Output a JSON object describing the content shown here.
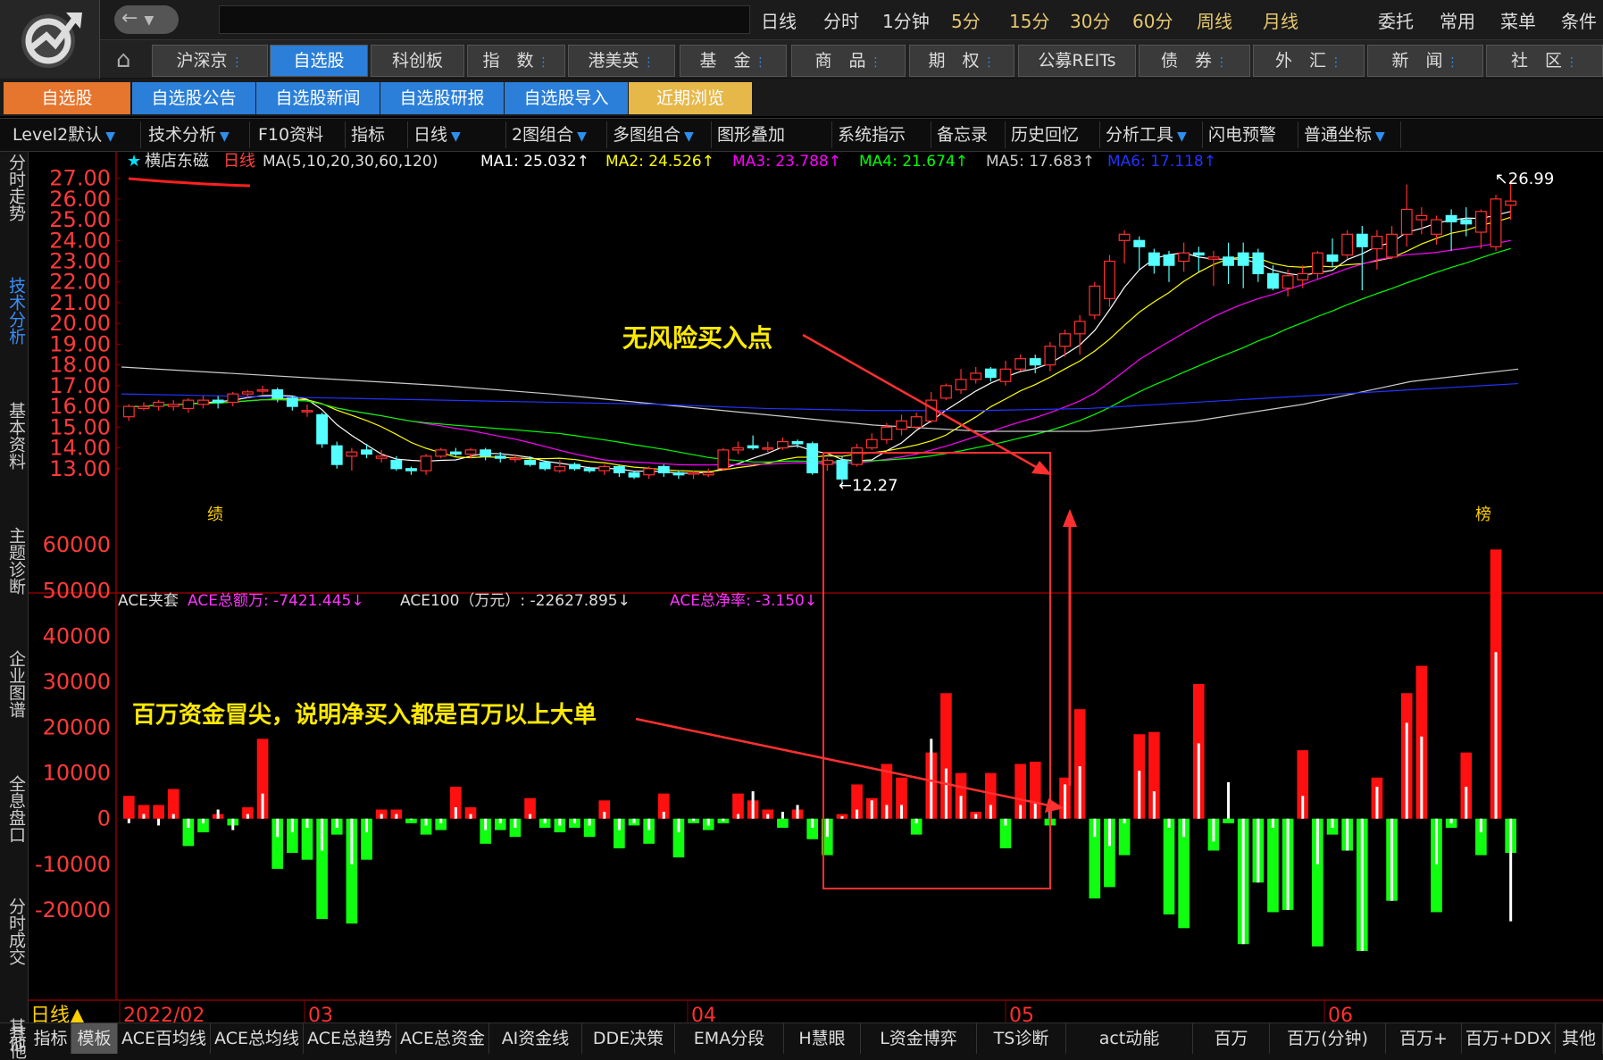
{
  "app": {
    "back_label": "←",
    "dropdown_icon": "chevron-down-icon"
  },
  "timeframes": [
    "日线",
    "分时",
    "1分钟",
    "5分",
    "15分",
    "30分",
    "60分",
    "周线",
    "月线"
  ],
  "top_right": [
    "委托",
    "常用",
    "菜单",
    "条件"
  ],
  "markets": [
    "沪深京",
    "自选股",
    "科创板",
    "指　数",
    "港美英",
    "基　金",
    "商　品",
    "期　权",
    "公募REITs",
    "债　券",
    "外　汇",
    "新　闻",
    "社　区"
  ],
  "subtabs": [
    "自选股",
    "自选股公告",
    "自选股新闻",
    "自选股研报",
    "自选股导入",
    "近期浏览"
  ],
  "toolbar": [
    "Level2默认",
    "技术分析",
    "F10资料",
    "指标",
    "日线",
    "2图组合",
    "多图组合",
    "图形叠加",
    "系统指示",
    "备忘录",
    "历史回忆",
    "分析工具",
    "闪电预警",
    "普通坐标"
  ],
  "side_tabs": [
    "分时走势",
    "技术分析",
    "基本资料",
    "主题诊断",
    "企业图谱",
    "全息盘口",
    "分时成交",
    "其他"
  ],
  "stock": {
    "name": "横店东磁",
    "period": "日线",
    "ma_params": "MA(5,10,20,30,60,120)",
    "ma": [
      {
        "label": "MA1:",
        "value": "25.032↑",
        "color": "#ffffff"
      },
      {
        "label": "MA2:",
        "value": "24.526↑",
        "color": "#ffff00"
      },
      {
        "label": "MA3:",
        "value": "23.788↑",
        "color": "#ff00ff"
      },
      {
        "label": "MA4:",
        "value": "21.674↑",
        "color": "#00ff00"
      },
      {
        "label": "MA5:",
        "value": "17.683↑",
        "color": "#cccccc"
      },
      {
        "label": "MA6:",
        "value": "17.118↑",
        "color": "#0000ff"
      }
    ]
  },
  "price_axis": [
    "27.00",
    "26.00",
    "25.00",
    "24.00",
    "23.00",
    "22.00",
    "21.00",
    "20.00",
    "19.00",
    "18.00",
    "17.00",
    "16.00",
    "15.00",
    "14.00",
    "13.00"
  ],
  "markers": {
    "high": "26.99",
    "low": "12.27",
    "left": "绩",
    "right": "榜"
  },
  "ace": {
    "title": "ACE夹套",
    "total_label": "ACE总额万:",
    "total": "-7421.445↓",
    "a100_label": "ACE100（万元）:",
    "a100": "-22627.895↓",
    "rate_label": "ACE总净率:",
    "rate": "-3.150↓"
  },
  "vol_axis": [
    "60000",
    "50000",
    "40000",
    "30000",
    "20000",
    "10000",
    "0",
    "-10000",
    "-20000"
  ],
  "dates": {
    "period_label": "日线▲",
    "d1": "2022/02",
    "d2": "03",
    "d3": "04",
    "d4": "05",
    "d5": "06"
  },
  "annotations": {
    "a1": "无风险买入点",
    "a2": "百万资金冒尖，说明净买入都是百万以上大单"
  },
  "bottom_tabs": [
    "指标",
    "模板",
    "ACE百均线",
    "ACE总均线",
    "ACE总趋势",
    "ACE总资金",
    "AI资金线",
    "DDE决策",
    "EMA分段",
    "H慧眼",
    "L资金博弈",
    "TS诊断",
    "act动能",
    "百万",
    "百万(分钟)",
    "百万+",
    "百万+DDX",
    "其他"
  ],
  "chart_data": {
    "type": "candlestick",
    "ylim": [
      12,
      27.5
    ],
    "candles": [
      [
        15.5,
        16.0,
        15.3,
        16.1
      ],
      [
        15.9,
        16.0,
        15.8,
        16.2
      ],
      [
        16.0,
        16.2,
        15.8,
        16.3
      ],
      [
        16.0,
        16.1,
        15.8,
        16.3
      ],
      [
        15.9,
        16.3,
        15.7,
        16.4
      ],
      [
        16.1,
        16.3,
        15.9,
        16.5
      ],
      [
        16.3,
        16.2,
        15.9,
        16.5
      ],
      [
        16.2,
        16.6,
        16.0,
        16.7
      ],
      [
        16.6,
        16.7,
        16.4,
        16.8
      ],
      [
        16.8,
        16.8,
        16.6,
        17.0
      ],
      [
        16.8,
        16.4,
        16.2,
        16.9
      ],
      [
        16.4,
        16.0,
        15.8,
        16.5
      ],
      [
        15.8,
        15.8,
        15.5,
        16.1
      ],
      [
        15.6,
        14.2,
        14.0,
        15.7
      ],
      [
        14.1,
        13.2,
        13.0,
        14.3
      ],
      [
        13.6,
        13.8,
        12.9,
        14.0
      ],
      [
        13.9,
        13.7,
        13.5,
        14.2
      ],
      [
        13.5,
        13.6,
        13.3,
        13.9
      ],
      [
        13.4,
        13.0,
        12.9,
        13.6
      ],
      [
        13.0,
        12.9,
        12.7,
        13.1
      ],
      [
        12.9,
        13.6,
        12.7,
        13.7
      ],
      [
        13.6,
        13.9,
        13.5,
        14.0
      ],
      [
        13.8,
        13.7,
        13.6,
        14.0
      ],
      [
        13.7,
        13.9,
        13.5,
        14.0
      ],
      [
        13.9,
        13.6,
        13.4,
        14.0
      ],
      [
        13.6,
        13.5,
        13.3,
        13.8
      ],
      [
        13.5,
        13.5,
        13.3,
        13.7
      ],
      [
        13.4,
        13.2,
        13.1,
        13.6
      ],
      [
        13.3,
        13.0,
        12.9,
        13.4
      ],
      [
        12.9,
        13.1,
        12.8,
        13.4
      ],
      [
        13.2,
        13.0,
        12.9,
        13.3
      ],
      [
        13.0,
        12.9,
        12.8,
        13.1
      ],
      [
        12.9,
        13.1,
        12.7,
        13.2
      ],
      [
        13.1,
        12.8,
        12.6,
        13.2
      ],
      [
        12.8,
        12.6,
        12.5,
        12.9
      ],
      [
        12.7,
        13.0,
        12.5,
        13.1
      ],
      [
        13.1,
        12.8,
        12.6,
        13.2
      ],
      [
        12.8,
        12.7,
        12.5,
        12.9
      ],
      [
        12.8,
        12.8,
        12.5,
        12.9
      ],
      [
        12.7,
        12.8,
        12.6,
        13.0
      ],
      [
        13.0,
        13.9,
        12.9,
        14.0
      ],
      [
        13.9,
        14.0,
        13.7,
        14.3
      ],
      [
        14.1,
        14.0,
        13.9,
        14.6
      ],
      [
        14.0,
        14.0,
        13.8,
        14.3
      ],
      [
        14.0,
        14.3,
        13.9,
        14.5
      ],
      [
        14.3,
        14.2,
        14.0,
        14.4
      ],
      [
        14.2,
        12.8,
        12.7,
        14.3
      ],
      [
        13.2,
        13.4,
        12.9,
        13.5
      ],
      [
        13.4,
        12.5,
        12.3,
        13.6
      ],
      [
        13.2,
        14.0,
        13.1,
        14.2
      ],
      [
        14.0,
        14.4,
        13.9,
        14.7
      ],
      [
        14.4,
        15.0,
        14.2,
        15.2
      ],
      [
        14.9,
        15.3,
        14.6,
        15.6
      ],
      [
        15.0,
        15.5,
        14.9,
        15.7
      ],
      [
        15.3,
        16.3,
        15.2,
        16.7
      ],
      [
        16.4,
        17.0,
        16.3,
        17.1
      ],
      [
        16.8,
        17.3,
        16.6,
        17.8
      ],
      [
        17.3,
        17.6,
        17.1,
        17.9
      ],
      [
        17.8,
        17.4,
        17.2,
        17.9
      ],
      [
        17.2,
        17.8,
        17.0,
        18.2
      ],
      [
        17.8,
        18.3,
        17.7,
        18.5
      ],
      [
        18.3,
        18.0,
        17.6,
        18.5
      ],
      [
        18.0,
        18.9,
        17.7,
        19.1
      ],
      [
        18.9,
        19.5,
        18.4,
        19.7
      ],
      [
        19.5,
        20.1,
        18.5,
        20.4
      ],
      [
        20.4,
        21.8,
        20.2,
        22.0
      ],
      [
        21.2,
        23.0,
        20.8,
        23.3
      ],
      [
        24.0,
        24.3,
        22.9,
        24.5
      ],
      [
        24.0,
        23.7,
        22.6,
        24.2
      ],
      [
        23.4,
        22.8,
        22.4,
        23.6
      ],
      [
        23.3,
        22.8,
        22.0,
        23.5
      ],
      [
        23.0,
        23.4,
        22.5,
        23.9
      ],
      [
        23.4,
        23.3,
        22.5,
        23.7
      ],
      [
        23.1,
        23.2,
        21.8,
        23.5
      ],
      [
        23.2,
        22.8,
        21.9,
        23.9
      ],
      [
        23.4,
        22.8,
        21.7,
        23.9
      ],
      [
        23.4,
        22.4,
        22.0,
        23.6
      ],
      [
        22.4,
        21.7,
        21.6,
        22.8
      ],
      [
        21.7,
        22.3,
        21.3,
        22.6
      ],
      [
        22.1,
        22.4,
        21.7,
        22.8
      ],
      [
        22.4,
        23.4,
        22.1,
        23.5
      ],
      [
        23.3,
        23.0,
        22.7,
        24.1
      ],
      [
        23.3,
        24.3,
        23.1,
        24.5
      ],
      [
        24.3,
        23.7,
        21.6,
        24.7
      ],
      [
        23.6,
        24.2,
        22.6,
        24.5
      ],
      [
        23.2,
        24.3,
        23.1,
        24.7
      ],
      [
        24.3,
        25.5,
        23.7,
        26.7
      ],
      [
        25.0,
        25.2,
        24.3,
        25.6
      ],
      [
        24.3,
        25.0,
        23.8,
        25.2
      ],
      [
        25.2,
        24.9,
        23.5,
        25.5
      ],
      [
        25.0,
        24.8,
        24.2,
        25.6
      ],
      [
        24.4,
        25.4,
        23.6,
        25.5
      ],
      [
        23.7,
        26.0,
        23.5,
        26.2
      ],
      [
        25.7,
        25.9,
        25.0,
        26.9
      ]
    ],
    "vol_ylim": [
      -30000,
      62000
    ],
    "ace_bars": [
      [
        5000,
        -1000
      ],
      [
        3000,
        1000
      ],
      [
        3000,
        -1500
      ],
      [
        6500,
        1000
      ],
      [
        -6000,
        -2000
      ],
      [
        -3000,
        -1000
      ],
      [
        1000,
        2000
      ],
      [
        -1500,
        -2500
      ],
      [
        2500,
        1000
      ],
      [
        17500,
        5500
      ],
      [
        -11000,
        -4000
      ],
      [
        -7500,
        -3000
      ],
      [
        -9000,
        -2000
      ],
      [
        -22000,
        -7000
      ],
      [
        -3500,
        -2000
      ],
      [
        -23000,
        -10000
      ],
      [
        -9000,
        -3000
      ],
      [
        2000,
        1000
      ],
      [
        2000,
        1000
      ],
      [
        -1000,
        0
      ],
      [
        -3500,
        -1500
      ],
      [
        -2500,
        -1000
      ],
      [
        7000,
        2500
      ],
      [
        2500,
        1000
      ],
      [
        -5500,
        -2500
      ],
      [
        -2500,
        -1000
      ],
      [
        -4000,
        -2000
      ],
      [
        4500,
        1000
      ],
      [
        -2000,
        -1000
      ],
      [
        -3000,
        -1500
      ],
      [
        -2000,
        -1000
      ],
      [
        -4000,
        -1500
      ],
      [
        4000,
        1500
      ],
      [
        -6500,
        -2500
      ],
      [
        -1500,
        -1000
      ],
      [
        -5500,
        -2500
      ],
      [
        5500,
        1500
      ],
      [
        -8500,
        -3000
      ],
      [
        -1000,
        -500
      ],
      [
        -2500,
        -1500
      ],
      [
        -1000,
        -500
      ],
      [
        5500,
        1000
      ],
      [
        4000,
        6000
      ],
      [
        2000,
        1000
      ],
      [
        -2000,
        1500
      ],
      [
        2000,
        3000
      ],
      [
        -4500,
        -2000
      ],
      [
        -8000,
        -4000
      ],
      [
        1000,
        500
      ],
      [
        7500,
        2000
      ],
      [
        4500,
        4000
      ],
      [
        12000,
        3000
      ],
      [
        9000,
        3000
      ],
      [
        -3500,
        -1000
      ],
      [
        14500,
        17500
      ],
      [
        27500,
        11000
      ],
      [
        10000,
        5000
      ],
      [
        1500,
        1000
      ],
      [
        10000,
        3000
      ],
      [
        -6500,
        -1500
      ],
      [
        12000,
        3000
      ],
      [
        12500,
        3500
      ],
      [
        -1500,
        2000
      ],
      [
        9000,
        7500
      ],
      [
        24000,
        11500
      ],
      [
        -17500,
        -4000
      ],
      [
        -15000,
        -6000
      ],
      [
        -8000,
        -1000
      ],
      [
        18500,
        10500
      ],
      [
        19000,
        6000
      ],
      [
        -21000,
        -2000
      ],
      [
        -24000,
        -4000
      ],
      [
        29500,
        16500
      ],
      [
        -7000,
        -5000
      ],
      [
        -1000,
        8000
      ],
      [
        -27500,
        -27500
      ],
      [
        -14000,
        -14000
      ],
      [
        -20500,
        -2000
      ],
      [
        -20000,
        -20000
      ],
      [
        15000,
        5000
      ],
      [
        -28000,
        -10000
      ],
      [
        -3500,
        -2000
      ],
      [
        -7000,
        -7000
      ],
      [
        -29000,
        -29000
      ],
      [
        9000,
        7000
      ],
      [
        -18000,
        -18000
      ],
      [
        27500,
        21000
      ],
      [
        33500,
        18000
      ],
      [
        -20500,
        -10000
      ],
      [
        -2000,
        -1000
      ],
      [
        14500,
        7000
      ],
      [
        -8000,
        -3000
      ],
      [
        59000,
        36500
      ],
      [
        -7500,
        -22500
      ]
    ]
  }
}
